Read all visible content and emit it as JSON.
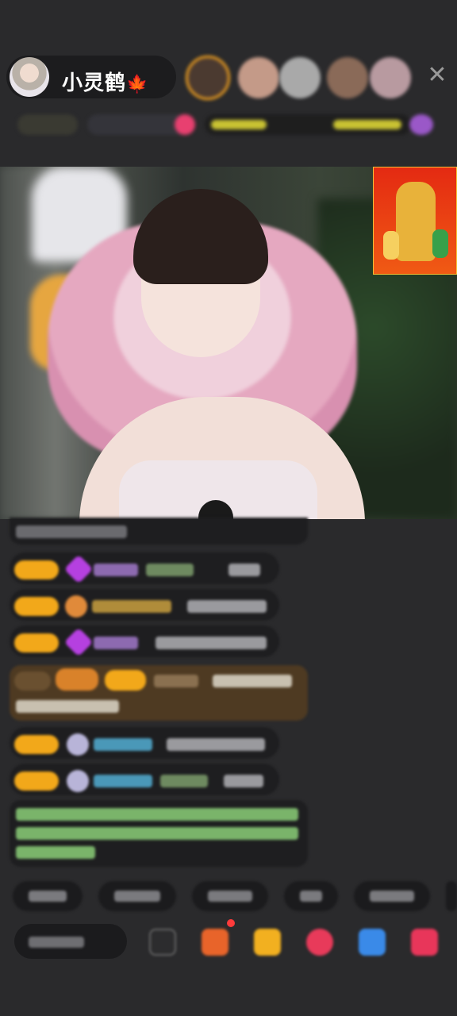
{
  "host": {
    "name": "小灵鹤",
    "badge": "🍁"
  },
  "close": {
    "glyph": "✕"
  },
  "colors": {
    "badge_gold": "#f2a81a",
    "highlight_brown": "#4e3a22",
    "gem_purple": "#b540e0"
  }
}
